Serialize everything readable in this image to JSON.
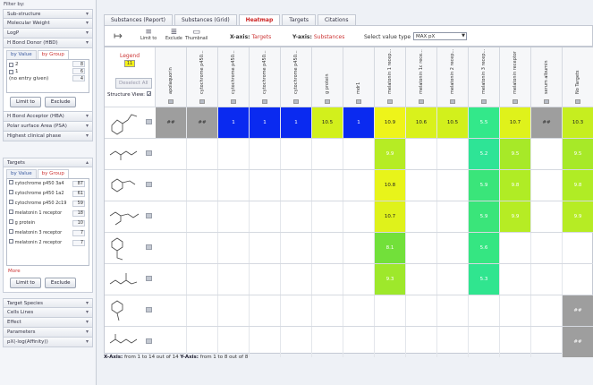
{
  "sidebar": {
    "filter_by": "Filter by:",
    "sections_top": [
      "Sub-structure",
      "Molecular Weight",
      "LogP",
      "H Bond Donor (HBD)"
    ],
    "hbd_panel": {
      "tabs": [
        "by Value",
        "by Group"
      ],
      "items": [
        {
          "label": "2",
          "count": "8"
        },
        {
          "label": "1",
          "count": "6"
        },
        {
          "label": "(no entry given)",
          "count": "4"
        }
      ],
      "limit_btn": "Limit to",
      "exclude_btn": "Exclude"
    },
    "sections_mid": [
      "H Bond Acceptor (HBA)",
      "Polar surface Area (PSA)",
      "Highest clinical phase"
    ],
    "targets_panel": {
      "title": "Targets",
      "tabs": [
        "by Value",
        "by Group"
      ],
      "items": [
        {
          "label": "cytochrome p450 3a4",
          "count": "87"
        },
        {
          "label": "cytochrome p450 1a2",
          "count": "61"
        },
        {
          "label": "cytochrome p450 2c19",
          "count": "59"
        },
        {
          "label": "melatonin 1 receptor",
          "count": "18"
        },
        {
          "label": "g protein",
          "count": "10"
        },
        {
          "label": "melatonin 3 receptor",
          "count": "7"
        },
        {
          "label": "melatonin 2 receptor",
          "count": "7"
        }
      ],
      "more": "More",
      "limit_btn": "Limit to",
      "exclude_btn": "Exclude"
    },
    "sections_bottom": [
      "Target Species",
      "Cells Lines",
      "Effect",
      "Parameters",
      "pX(-log(Affinity))"
    ]
  },
  "tabs": [
    "Substances (Report)",
    "Substances (Grid)",
    "Heatmap",
    "Targets",
    "Citations"
  ],
  "toolbar": {
    "limit_to": "Limit to",
    "exclude": "Exclude",
    "thumbnail": "Thumbnail",
    "x_axis_label": "X-axis:",
    "x_axis_value": "Targets",
    "y_axis_label": "Y-axis:",
    "y_axis_value": "Substances",
    "value_type_label": "Select value type",
    "value_type": "MAX pX"
  },
  "heatmap": {
    "legend_title": "Legend",
    "legend_value": "11",
    "deselect_all": "Deselect All",
    "structure_view": "Structure View:",
    "columns": [
      "apolaquorin",
      "cytochrome p450...",
      "cytochrome p450...",
      "cytochrome p450...",
      "cytochrome p450...",
      "g protein",
      "mdr1",
      "melatonin 1 recep...",
      "melatonin 1c rece...",
      "melatonin 2 recep...",
      "melatonin 3 recep...",
      "melatonin receptor",
      "serum albumin",
      "No Targets"
    ],
    "rows": [
      {
        "cells": [
          [
            "##",
            "#9e9e9e",
            "#333"
          ],
          [
            "##",
            "#9e9e9e",
            "#333"
          ],
          [
            "1",
            "#0a2af0",
            "#fff"
          ],
          [
            "1",
            "#0a2af0",
            "#fff"
          ],
          [
            "1",
            "#0a2af0",
            "#fff"
          ],
          [
            "10.5",
            "#d2f01c",
            "#222"
          ],
          [
            "1",
            "#0a2af0",
            "#fff"
          ],
          [
            "10.9",
            "#eef41a",
            "#222"
          ],
          [
            "10.6",
            "#d9f11c",
            "#222"
          ],
          [
            "10.5",
            "#d2f01c",
            "#222"
          ],
          [
            "5.5",
            "#33e88a",
            "#fff"
          ],
          [
            "10.7",
            "#dff21b",
            "#222"
          ],
          [
            "##",
            "#9e9e9e",
            "#333"
          ],
          [
            "10.3",
            "#c6ee1f",
            "#222"
          ]
        ]
      },
      {
        "cells": [
          [
            "",
            ""
          ],
          [
            "",
            ""
          ],
          [
            "",
            ""
          ],
          [
            "",
            ""
          ],
          [
            "",
            ""
          ],
          [
            "",
            ""
          ],
          [
            "",
            ""
          ],
          [
            "9.9",
            "#b6ec24",
            "#fff"
          ],
          [
            "",
            ""
          ],
          [
            "",
            ""
          ],
          [
            "5.2",
            "#2ee496",
            "#fff"
          ],
          [
            "9.5",
            "#a7e928",
            "#fff"
          ],
          [
            "",
            ""
          ],
          [
            "9.5",
            "#a7e928",
            "#fff"
          ]
        ]
      },
      {
        "cells": [
          [
            "",
            ""
          ],
          [
            "",
            ""
          ],
          [
            "",
            ""
          ],
          [
            "",
            ""
          ],
          [
            "",
            ""
          ],
          [
            "",
            ""
          ],
          [
            "",
            ""
          ],
          [
            "10.8",
            "#e8f41a",
            "#222"
          ],
          [
            "",
            ""
          ],
          [
            "",
            ""
          ],
          [
            "5.9",
            "#3ae57a",
            "#fff"
          ],
          [
            "9.8",
            "#b0ec25",
            "#fff"
          ],
          [
            "",
            ""
          ],
          [
            "9.8",
            "#b0ec25",
            "#fff"
          ]
        ]
      },
      {
        "cells": [
          [
            "",
            ""
          ],
          [
            "",
            ""
          ],
          [
            "",
            ""
          ],
          [
            "",
            ""
          ],
          [
            "",
            ""
          ],
          [
            "",
            ""
          ],
          [
            "",
            ""
          ],
          [
            "10.7",
            "#dff21b",
            "#222"
          ],
          [
            "",
            ""
          ],
          [
            "",
            ""
          ],
          [
            "5.9",
            "#3ae57a",
            "#fff"
          ],
          [
            "9.9",
            "#b6ec24",
            "#fff"
          ],
          [
            "",
            ""
          ],
          [
            "9.9",
            "#b6ec24",
            "#fff"
          ]
        ]
      },
      {
        "cells": [
          [
            "",
            ""
          ],
          [
            "",
            ""
          ],
          [
            "",
            ""
          ],
          [
            "",
            ""
          ],
          [
            "",
            ""
          ],
          [
            "",
            ""
          ],
          [
            "",
            ""
          ],
          [
            "8.1",
            "#72e03a",
            "#fff"
          ],
          [
            "",
            ""
          ],
          [
            "",
            ""
          ],
          [
            "5.6",
            "#35e682",
            "#fff"
          ],
          [
            "",
            ""
          ],
          [
            "",
            ""
          ],
          [
            "",
            ""
          ]
        ]
      },
      {
        "cells": [
          [
            "",
            ""
          ],
          [
            "",
            ""
          ],
          [
            "",
            ""
          ],
          [
            "",
            ""
          ],
          [
            "",
            ""
          ],
          [
            "",
            ""
          ],
          [
            "",
            ""
          ],
          [
            "9.3",
            "#9ee82b",
            "#fff"
          ],
          [
            "",
            ""
          ],
          [
            "",
            ""
          ],
          [
            "5.3",
            "#30e58f",
            "#fff"
          ],
          [
            "",
            ""
          ],
          [
            "",
            ""
          ],
          [
            "",
            ""
          ]
        ]
      },
      {
        "cells": [
          [
            "",
            ""
          ],
          [
            "",
            ""
          ],
          [
            "",
            ""
          ],
          [
            "",
            ""
          ],
          [
            "",
            ""
          ],
          [
            "",
            ""
          ],
          [
            "",
            ""
          ],
          [
            "",
            ""
          ],
          [
            "",
            ""
          ],
          [
            "",
            ""
          ],
          [
            "",
            ""
          ],
          [
            "",
            ""
          ],
          [
            "",
            ""
          ],
          [
            "##",
            "#9e9e9e",
            "#fff"
          ]
        ]
      },
      {
        "cells": [
          [
            "",
            ""
          ],
          [
            "",
            ""
          ],
          [
            "",
            ""
          ],
          [
            "",
            ""
          ],
          [
            "",
            ""
          ],
          [
            "",
            ""
          ],
          [
            "",
            ""
          ],
          [
            "",
            ""
          ],
          [
            "",
            ""
          ],
          [
            "",
            ""
          ],
          [
            "",
            ""
          ],
          [
            "",
            ""
          ],
          [
            "",
            ""
          ],
          [
            "##",
            "#9e9e9e",
            "#fff"
          ]
        ]
      }
    ]
  },
  "footer": {
    "x_label": "X-Axis:",
    "x_text": "from 1 to 14 out of 14",
    "y_label": "Y-Axis:",
    "y_text": "from 1 to 8 out of 8"
  }
}
